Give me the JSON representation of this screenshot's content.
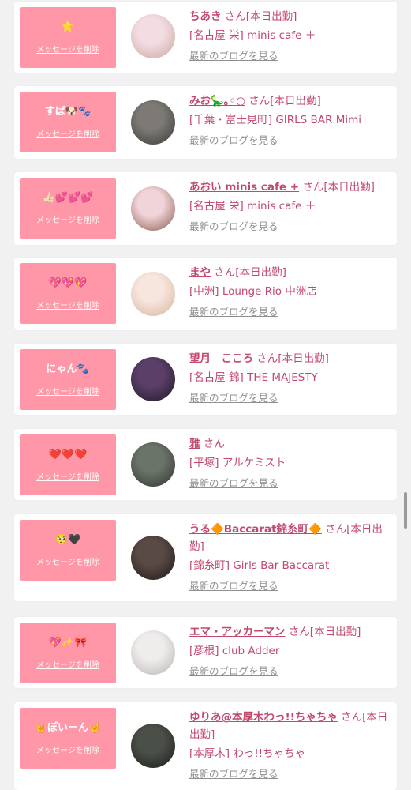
{
  "colors": {
    "accent": "#ff97a8",
    "text_pink": "#c2486c",
    "link_gray": "#8f8f8f",
    "background": "#f1f1f1"
  },
  "common": {
    "delete_label": "メッセージを削除",
    "blog_label": "最新のブログを見る"
  },
  "items": [
    {
      "stamp": "⭐",
      "name": "ちあき",
      "suffix": "さん[本日出勤]",
      "shop": "[名古屋 栄] minis cafe ＋",
      "avatar_colors": [
        "#f3dde2",
        "#c9a59d"
      ]
    },
    {
      "stamp": "すば🐶🐾",
      "name": "みお🦕｡◦○",
      "suffix": "さん[本日出勤]",
      "shop": "[千葉・富士見町] GIRLS BAR Mimi",
      "avatar_colors": [
        "#7d7a76",
        "#3a3835"
      ]
    },
    {
      "stamp": "👍🏻💕💕💕",
      "name": "あおい minis cafe +",
      "suffix": "さん[本日出勤]",
      "shop": "[名古屋 栄] minis cafe ＋",
      "avatar_colors": [
        "#f1d4da",
        "#8a5a4c"
      ]
    },
    {
      "stamp": "💖💖💖",
      "name": "まや",
      "suffix": "さん[本日出勤]",
      "shop": "[中洲] Lounge Rio 中洲店",
      "avatar_colors": [
        "#f6e6dd",
        "#d8b29a"
      ]
    },
    {
      "stamp": "にゃん🐾",
      "name": "望月　こころ",
      "suffix": "さん[本日出勤]",
      "shop": "[名古屋 錦] THE MAJESTY",
      "avatar_colors": [
        "#5b3f69",
        "#1e1825"
      ]
    },
    {
      "stamp": "❤️❤️❤️",
      "name": "雅",
      "suffix": "さん",
      "shop": "[平塚] アルケミスト",
      "avatar_colors": [
        "#6b7468",
        "#2f3330"
      ]
    },
    {
      "stamp": "🥺🖤",
      "name": "うる🔶Baccarat錦糸町🔶",
      "suffix": "さん[本日出勤]",
      "shop": "[錦糸町] Girls Bar Baccarat",
      "avatar_colors": [
        "#5a4a46",
        "#1d1716"
      ]
    },
    {
      "stamp": "💖✨🎀",
      "name": "エマ・アッカーマン",
      "suffix": "さん[本日出勤]",
      "shop": "[彦根] club Adder",
      "avatar_colors": [
        "#efecec",
        "#b9b3b3"
      ]
    },
    {
      "stamp": "🤘ぽいーん🤘",
      "name": "ゆりあ@本厚木わっ!!ちゃちゃ",
      "suffix": "さん[本日出勤]",
      "shop": "[本厚木] わっ!!ちゃちゃ",
      "avatar_colors": [
        "#4a4f48",
        "#1b1e1a"
      ]
    }
  ]
}
